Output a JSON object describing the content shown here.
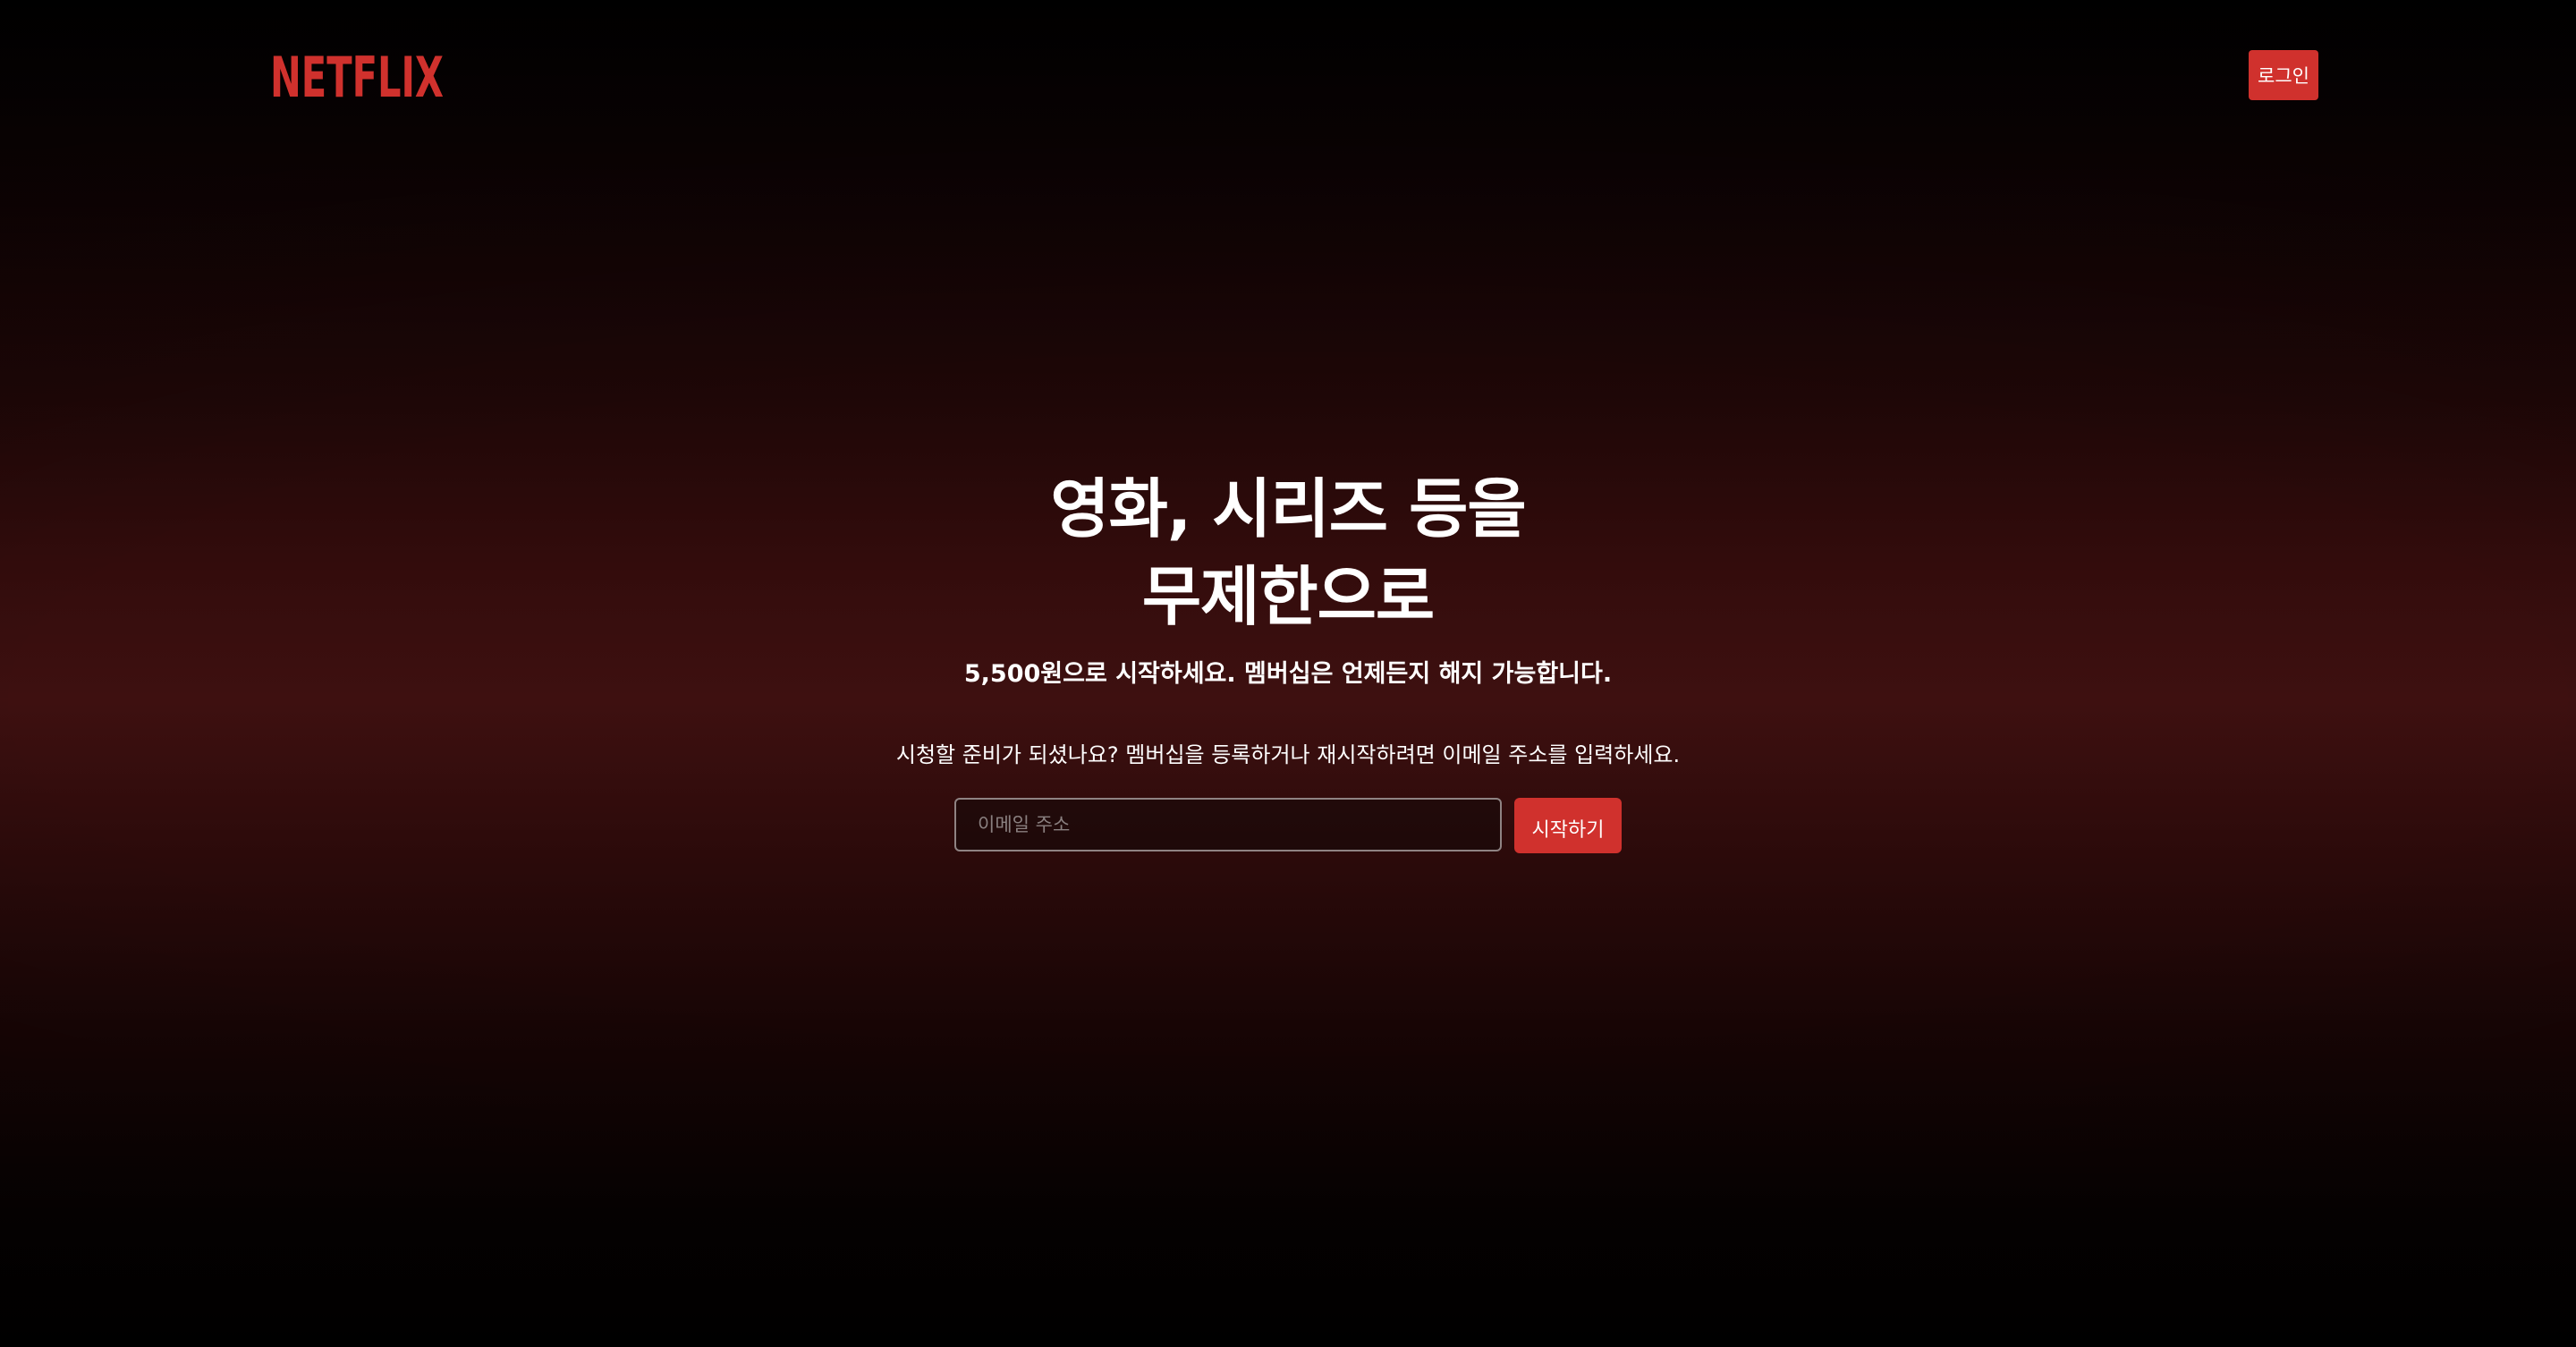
{
  "brand": {
    "logo_text": "NETFLIX",
    "logo_color": "#d0312d"
  },
  "header": {
    "login_label": "로그인"
  },
  "hero": {
    "title_line1": "영화, 시리즈 등을",
    "title_line2": "무제한으로",
    "subtitle": "5,500원으로 시작하세요. 멤버십은 언제든지 해지 가능합니다.",
    "prompt": "시청할 준비가 되셨나요? 멤버십을 등록하거나 재시작하려면 이메일 주소를 입력하세요."
  },
  "signup": {
    "email_placeholder": "이메일 주소",
    "email_value": "",
    "start_label": "시작하기"
  },
  "colors": {
    "accent": "#d0312d",
    "background": "#000000"
  }
}
